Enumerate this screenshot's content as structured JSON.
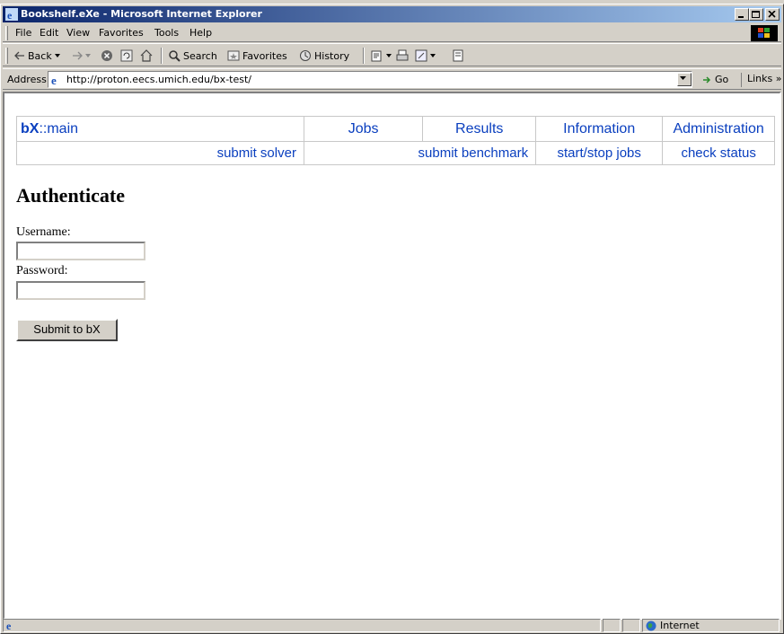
{
  "window": {
    "title": "Bookshelf.eXe - Microsoft Internet Explorer"
  },
  "menu": [
    "File",
    "Edit",
    "View",
    "Favorites",
    "Tools",
    "Help"
  ],
  "toolbar": {
    "back": "Back",
    "search": "Search",
    "favorites": "Favorites",
    "history": "History"
  },
  "address": {
    "label": "Address",
    "url": "http://proton.eecs.umich.edu/bx-test/",
    "go": "Go",
    "links": "Links"
  },
  "nav": {
    "brand_bold": "bX",
    "brand_rest": "::main",
    "top": [
      "Jobs",
      "Results",
      "Information",
      "Administration"
    ],
    "sub": [
      "submit solver",
      "submit benchmark",
      "start/stop jobs",
      "check status"
    ]
  },
  "form": {
    "title": "Authenticate",
    "username_label": "Username:",
    "password_label": "Password:",
    "username_value": "",
    "password_value": "",
    "submit_label": "Submit to bX"
  },
  "status": {
    "zone": "Internet"
  }
}
